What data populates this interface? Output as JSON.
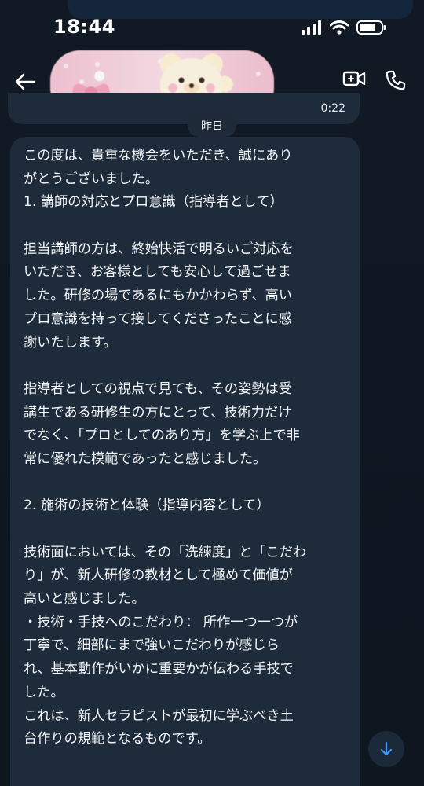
{
  "status_bar": {
    "time": "18:44",
    "icons": [
      "cellular-signal-icon",
      "wifi-icon",
      "battery-icon"
    ]
  },
  "header": {
    "back_icon": "back-arrow-icon",
    "contact_image": "pink-bear-banner-image",
    "actions": [
      "video-call-icon",
      "voice-call-icon"
    ]
  },
  "previous_message": {
    "duration": "0:22"
  },
  "date_separator": "昨日",
  "message": {
    "lines": [
      "この度は、貴重な機会をいただき、誠にあり",
      "がとうございました。",
      "1. 講師の対応とプロ意識（指導者として）",
      "",
      "担当講師の方は、終始快活で明るいご対応を",
      "いただき、お客様としても安心して過ごせま",
      "した。研修の場であるにもかかわらず、高い",
      "プロ意識を持って接してくださったことに感",
      "謝いたします。",
      "",
      "指導者としての視点で見ても、その姿勢は受",
      "講生である研修生の方にとって、技術力だけ",
      "でなく、「プロとしてのあり方」を学ぶ上で非",
      "常に優れた模範であったと感じました。",
      "",
      "2. 施術の技術と体験（指導内容として）",
      "",
      "技術面においては、その「洗練度」と「こだわ",
      "り」が、新人研修の教材として極めて価値が",
      "高いと感じました。",
      "・技術・手技へのこだわり： 所作一つ一つが",
      "丁寧で、細部にまで強いこだわりが感じら",
      "れ、基本動作がいかに重要かが伝わる手技で",
      "した。",
      "これは、新人セラピストが最初に学ぶべき土",
      "台作りの規範となるものです。"
    ]
  },
  "scroll_button_icon": "arrow-down-icon",
  "colors": {
    "background": "#0f1722",
    "bubble": "#1e2b3a",
    "accent": "#3d9cff",
    "text": "#f4f7fa"
  }
}
